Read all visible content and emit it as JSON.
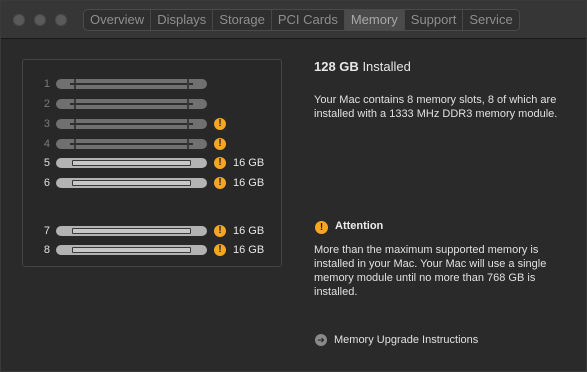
{
  "window": {
    "traffic_lights": [
      "close",
      "minimize",
      "zoom"
    ]
  },
  "tabs": [
    {
      "label": "Overview",
      "active": false
    },
    {
      "label": "Displays",
      "active": false
    },
    {
      "label": "Storage",
      "active": false
    },
    {
      "label": "PCI Cards",
      "active": false
    },
    {
      "label": "Memory",
      "active": true
    },
    {
      "label": "Support",
      "active": false
    },
    {
      "label": "Service",
      "active": false
    }
  ],
  "slots": [
    {
      "number": "1",
      "populated": false,
      "warning": false,
      "capacity": ""
    },
    {
      "number": "2",
      "populated": false,
      "warning": false,
      "capacity": ""
    },
    {
      "number": "3",
      "populated": false,
      "warning": true,
      "capacity": ""
    },
    {
      "number": "4",
      "populated": false,
      "warning": true,
      "capacity": ""
    },
    {
      "number": "5",
      "populated": true,
      "warning": true,
      "capacity": "16 GB"
    },
    {
      "number": "6",
      "populated": true,
      "warning": true,
      "capacity": "16 GB"
    },
    {
      "number": "7",
      "populated": true,
      "warning": true,
      "capacity": "16 GB"
    },
    {
      "number": "8",
      "populated": true,
      "warning": true,
      "capacity": "16 GB"
    }
  ],
  "summary": {
    "amount": "128 GB",
    "suffix": "Installed",
    "description": "Your Mac contains 8 memory slots, 8 of which are installed with a 1333 MHz DDR3 memory module."
  },
  "attention": {
    "icon": "warning-icon",
    "title": "Attention",
    "text": "More than the maximum supported memory is installed in your Mac. Your Mac will use a single memory module until no more than 768 GB is installed."
  },
  "link": {
    "icon": "arrow-circle-icon",
    "label": "Memory Upgrade Instructions"
  },
  "colors": {
    "warning": "#f5a623",
    "background": "#2a2a2a"
  }
}
